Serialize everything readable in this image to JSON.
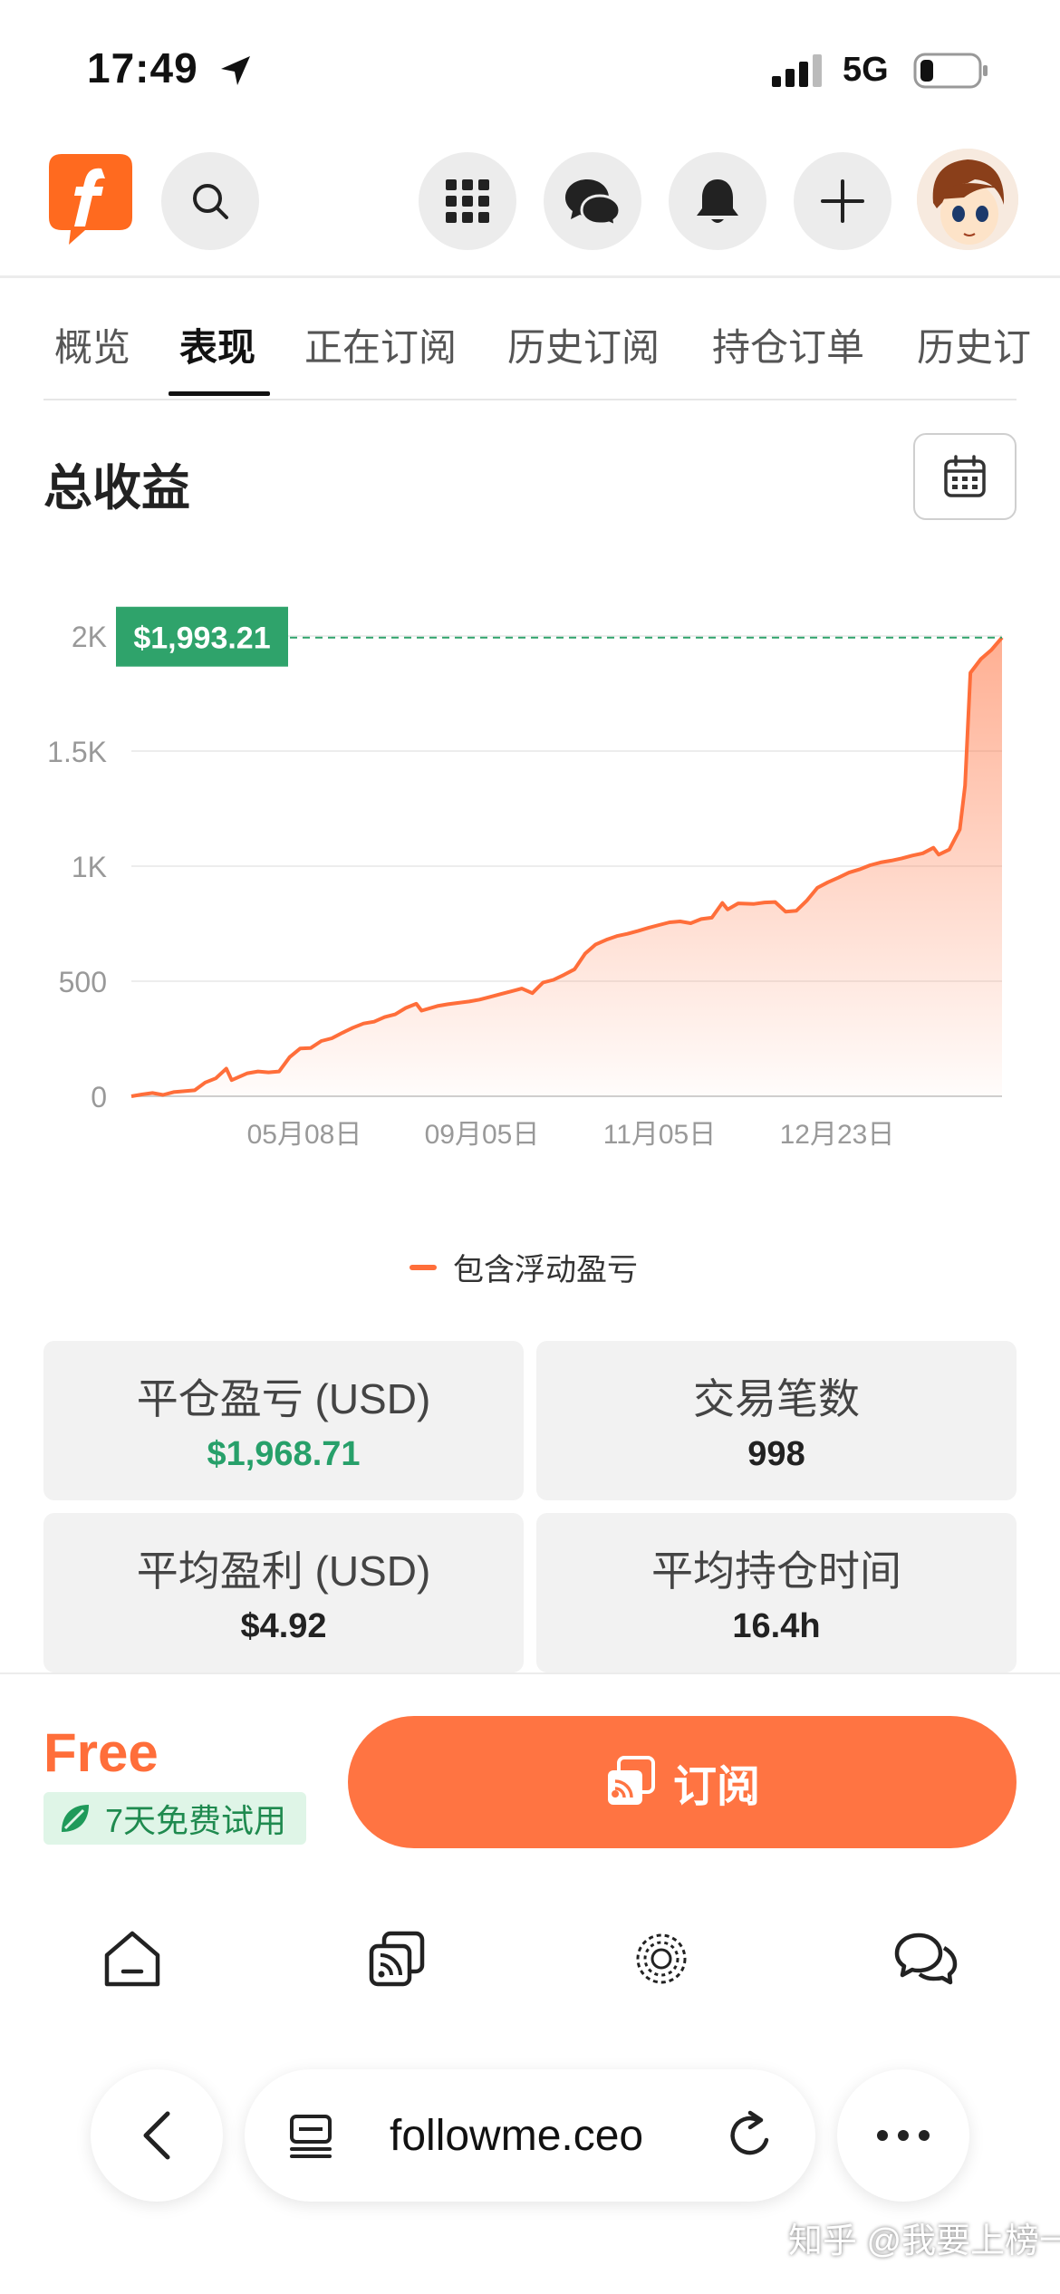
{
  "status_bar": {
    "time": "17:49",
    "network": "5G"
  },
  "header": {
    "logo_icon": "followme-f-logo",
    "buttons": [
      "search-icon",
      "apps-grid-icon",
      "chat-icon",
      "bell-icon",
      "plus-icon"
    ],
    "avatar": "avatar"
  },
  "tabs": [
    {
      "label": "概览"
    },
    {
      "label": "表现",
      "active": true
    },
    {
      "label": "正在订阅"
    },
    {
      "label": "历史订阅"
    },
    {
      "label": "持仓订单"
    },
    {
      "label": "历史订"
    }
  ],
  "section": {
    "title": "总收益",
    "calendar_icon": "calendar-icon"
  },
  "chart_data": {
    "type": "area",
    "yticks": [
      "2K",
      "1.5K",
      "1K",
      "500",
      "0"
    ],
    "ylim": [
      0,
      2000
    ],
    "xticks": [
      "05月08日",
      "09月05日",
      "11月05日",
      "12月23日"
    ],
    "latest_value_label": "$1,993.21",
    "latest_value": 1993.21,
    "series": [
      {
        "name": "包含浮动盈亏",
        "color": "#ff6e3a",
        "points": [
          [
            0,
            0
          ],
          [
            2,
            8
          ],
          [
            4,
            14
          ],
          [
            6,
            6
          ],
          [
            8,
            18
          ],
          [
            10,
            22
          ],
          [
            12,
            26
          ],
          [
            14,
            60
          ],
          [
            16,
            78
          ],
          [
            18,
            120
          ],
          [
            19,
            70
          ],
          [
            22,
            100
          ],
          [
            24,
            108
          ],
          [
            26,
            104
          ],
          [
            28,
            108
          ],
          [
            30,
            170
          ],
          [
            32,
            208
          ],
          [
            34,
            210
          ],
          [
            36,
            240
          ],
          [
            38,
            252
          ],
          [
            40,
            276
          ],
          [
            42,
            298
          ],
          [
            44,
            316
          ],
          [
            46,
            324
          ],
          [
            48,
            344
          ],
          [
            50,
            356
          ],
          [
            52,
            384
          ],
          [
            54,
            402
          ],
          [
            55,
            372
          ],
          [
            58,
            392
          ],
          [
            60,
            400
          ],
          [
            62,
            406
          ],
          [
            64,
            412
          ],
          [
            66,
            420
          ],
          [
            68,
            432
          ],
          [
            70,
            444
          ],
          [
            72,
            456
          ],
          [
            74,
            468
          ],
          [
            76,
            448
          ],
          [
            78,
            494
          ],
          [
            80,
            506
          ],
          [
            82,
            528
          ],
          [
            84,
            552
          ],
          [
            86,
            620
          ],
          [
            88,
            660
          ],
          [
            90,
            680
          ],
          [
            92,
            696
          ],
          [
            94,
            706
          ],
          [
            96,
            718
          ],
          [
            98,
            732
          ],
          [
            100,
            744
          ],
          [
            102,
            756
          ],
          [
            104,
            760
          ],
          [
            106,
            752
          ],
          [
            108,
            770
          ],
          [
            110,
            776
          ],
          [
            112,
            840
          ],
          [
            113,
            812
          ],
          [
            115,
            838
          ],
          [
            118,
            836
          ],
          [
            120,
            842
          ],
          [
            122,
            844
          ],
          [
            124,
            802
          ],
          [
            126,
            806
          ],
          [
            128,
            850
          ],
          [
            130,
            906
          ],
          [
            132,
            930
          ],
          [
            134,
            950
          ],
          [
            136,
            972
          ],
          [
            138,
            986
          ],
          [
            140,
            1004
          ],
          [
            142,
            1016
          ],
          [
            144,
            1024
          ],
          [
            146,
            1034
          ],
          [
            148,
            1046
          ],
          [
            150,
            1056
          ],
          [
            152,
            1080
          ],
          [
            153,
            1050
          ],
          [
            155,
            1072
          ],
          [
            157,
            1160
          ],
          [
            158,
            1350
          ],
          [
            159,
            1840
          ],
          [
            161,
            1900
          ],
          [
            163,
            1940
          ],
          [
            165,
            1993.21
          ]
        ]
      }
    ]
  },
  "stats": [
    {
      "label": "平仓盈亏 (USD)",
      "value": "$1,968.71",
      "positive": true
    },
    {
      "label": "交易笔数",
      "value": "998"
    },
    {
      "label": "平均盈利 (USD)",
      "value": "$4.92"
    },
    {
      "label": "平均持仓时间",
      "value": "16.4h"
    }
  ],
  "subscribe": {
    "price": "Free",
    "trial": "7天免费试用",
    "button_label": "订阅"
  },
  "bottom_nav": [
    "home-icon",
    "copy-trade-icon",
    "discover-icon",
    "messages-icon"
  ],
  "browser": {
    "url": "followme.ceo"
  },
  "watermark": "知乎 @我要上榜一"
}
